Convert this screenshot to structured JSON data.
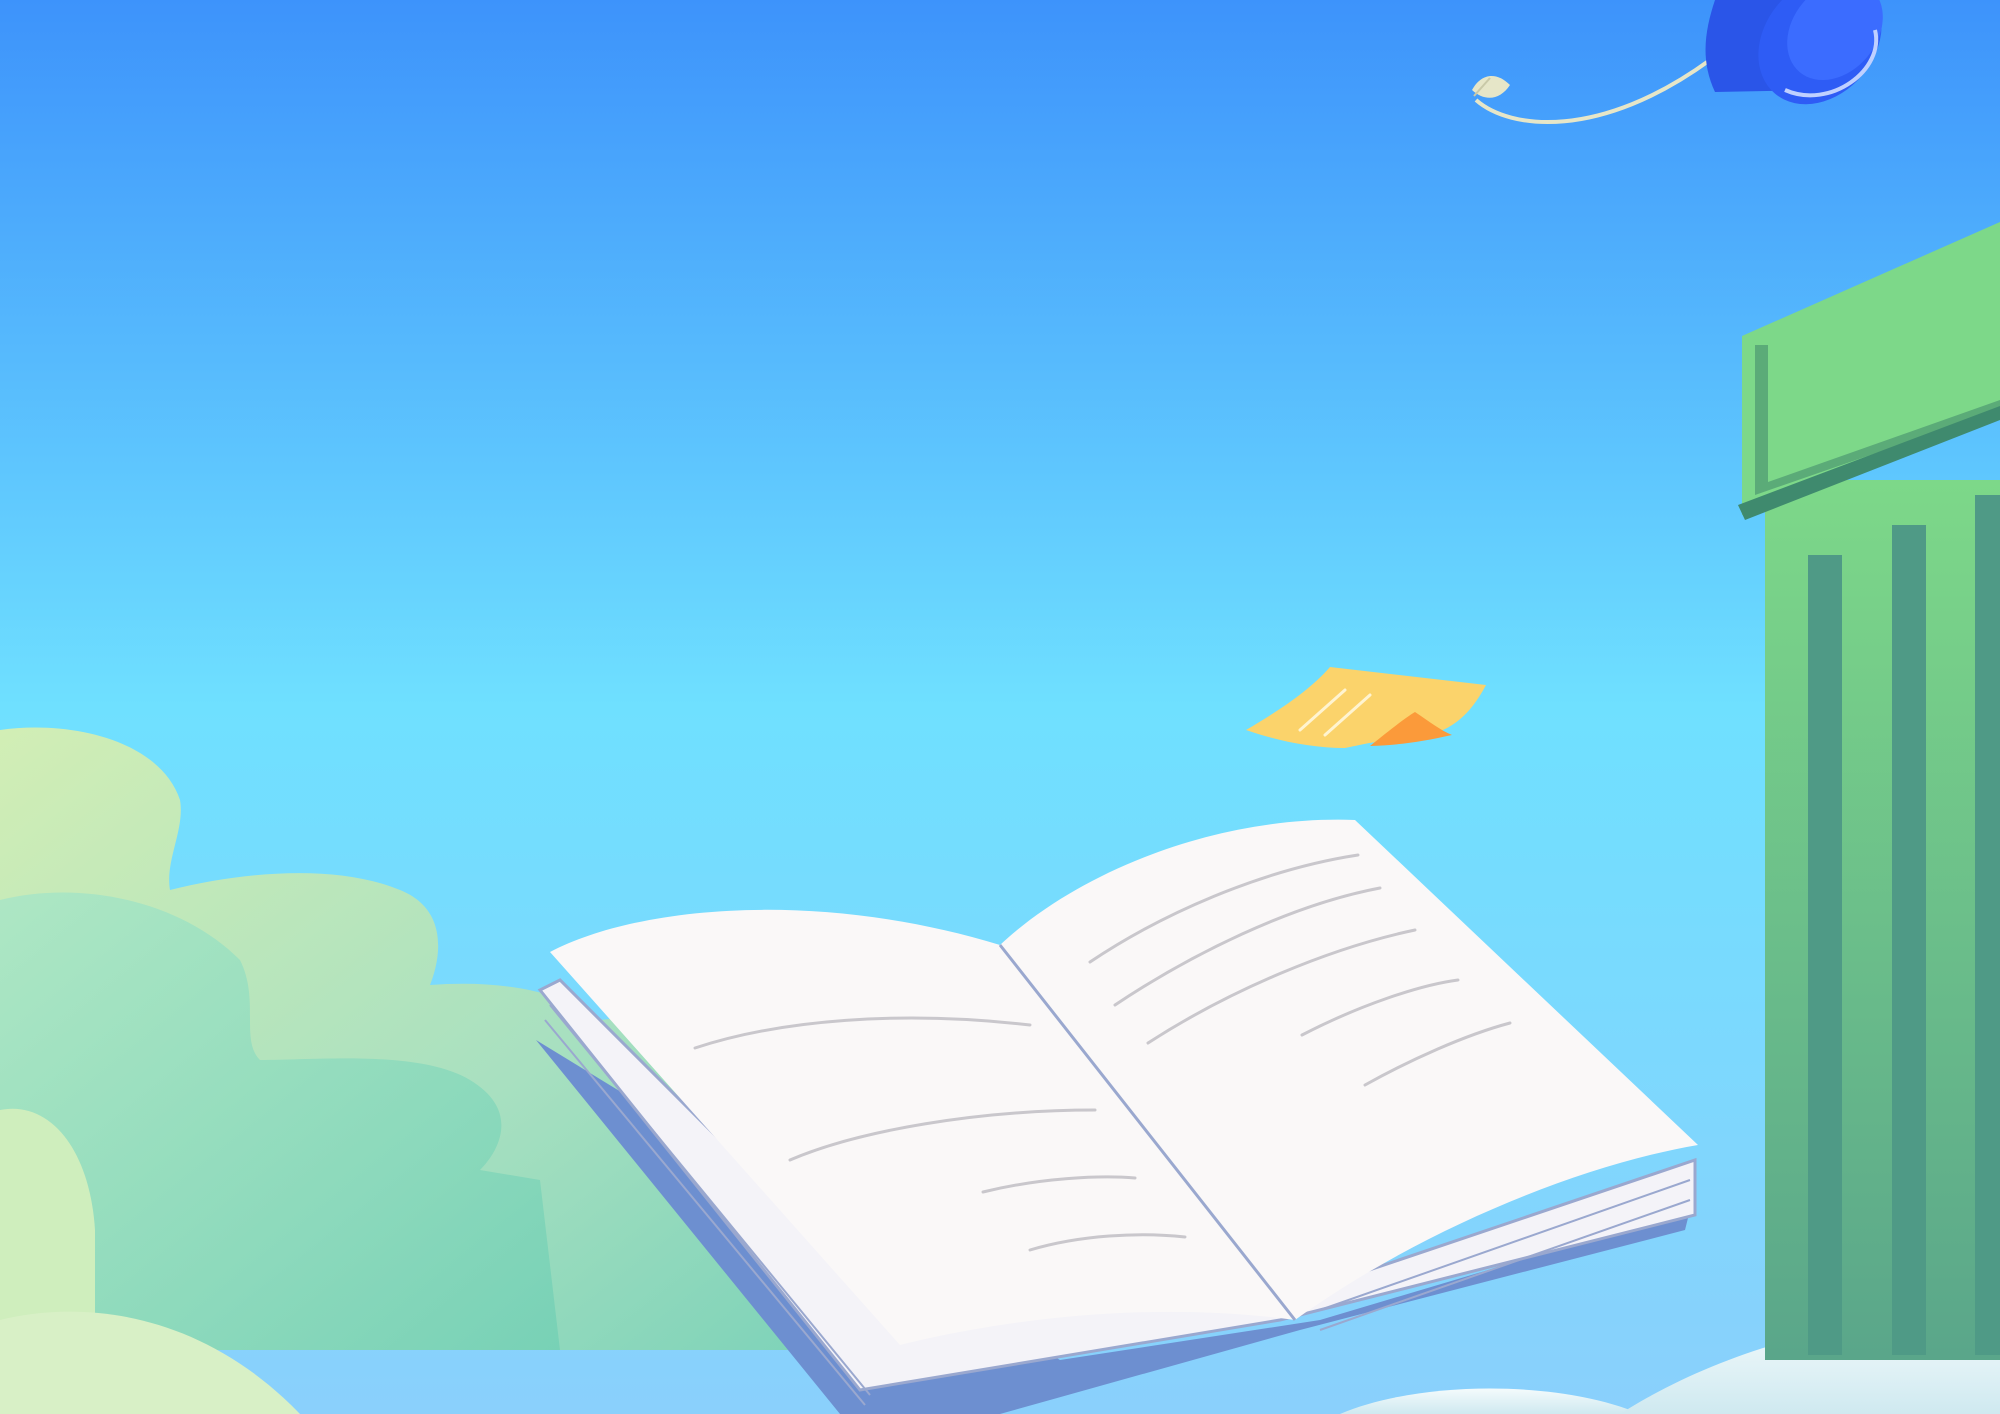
{
  "scene": {
    "kind": "illustration",
    "elements": [
      "sky",
      "cloud-left",
      "open-book",
      "sticky-note",
      "graduation-cap",
      "column-right",
      "snow-ground"
    ]
  },
  "colors": {
    "sky_top": "#3d93fb",
    "sky_mid": "#6fe0ff",
    "sky_bottom": "#8ad0fc",
    "cloud_light": "#d2eeb5",
    "cloud_mid": "#a8e0c0",
    "cloud_dark": "#7fd3b9",
    "book_page": "#faf8f8",
    "book_edge": "#9aa8cf",
    "book_cover": "#6d8fd0",
    "note_yellow": "#fbd36b",
    "note_orange": "#fb9a3a",
    "cap_blue": "#2e5cf5",
    "cap_tassel": "#e6e6c8",
    "column_light": "#7dd889",
    "column_mid": "#6fbd87",
    "column_dark": "#4f9a86",
    "snow": "#e4f3f5"
  }
}
